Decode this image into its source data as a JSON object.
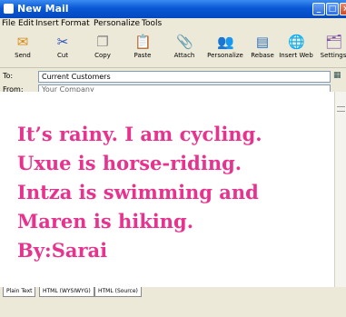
{
  "window": {
    "title": "New Mail"
  },
  "menu": [
    "File",
    "Edit",
    "Insert",
    "Format",
    "Personalize",
    "Tools"
  ],
  "toolbar": [
    {
      "label": "Send",
      "icon": "send-icon",
      "glyph": "✉",
      "color": "#d88a1a"
    },
    {
      "label": "Cut",
      "icon": "cut-icon",
      "glyph": "✂",
      "color": "#2a4fbf"
    },
    {
      "label": "Copy",
      "icon": "copy-icon",
      "glyph": "❐",
      "color": "#888"
    },
    {
      "label": "Paste",
      "icon": "paste-icon",
      "glyph": "📋",
      "color": "#c9a24a"
    },
    {
      "label": "Attach",
      "icon": "attach-icon",
      "glyph": "📎",
      "color": "#3a9a2a"
    },
    {
      "label": "Personalize",
      "icon": "personalize-icon",
      "glyph": "👥",
      "color": "#c55a1a"
    },
    {
      "label": "Rebase",
      "icon": "rebase-icon",
      "glyph": "▤",
      "color": "#2a6fbf"
    },
    {
      "label": "Insert Web",
      "icon": "globe-icon",
      "glyph": "🌐",
      "color": "#2a8a3a"
    },
    {
      "label": "Settings",
      "icon": "settings-icon",
      "glyph": "🗂",
      "color": "#7a4aa0"
    }
  ],
  "to": {
    "label": "To:",
    "value": "Current Customers"
  },
  "from": {
    "label": "From:",
    "value": "Your Company"
  },
  "message": [
    "It’s rainy. I am cycling.",
    "Uxue is horse-riding.",
    "Intza is swimming and",
    "Maren is hiking.",
    "By:Sarai"
  ],
  "tabs": [
    "Plain Text",
    "HTML (WYSIWYG)",
    "HTML (Source)"
  ],
  "colors": {
    "accent": "#e8338e",
    "titlebar": "#0a58d6"
  }
}
